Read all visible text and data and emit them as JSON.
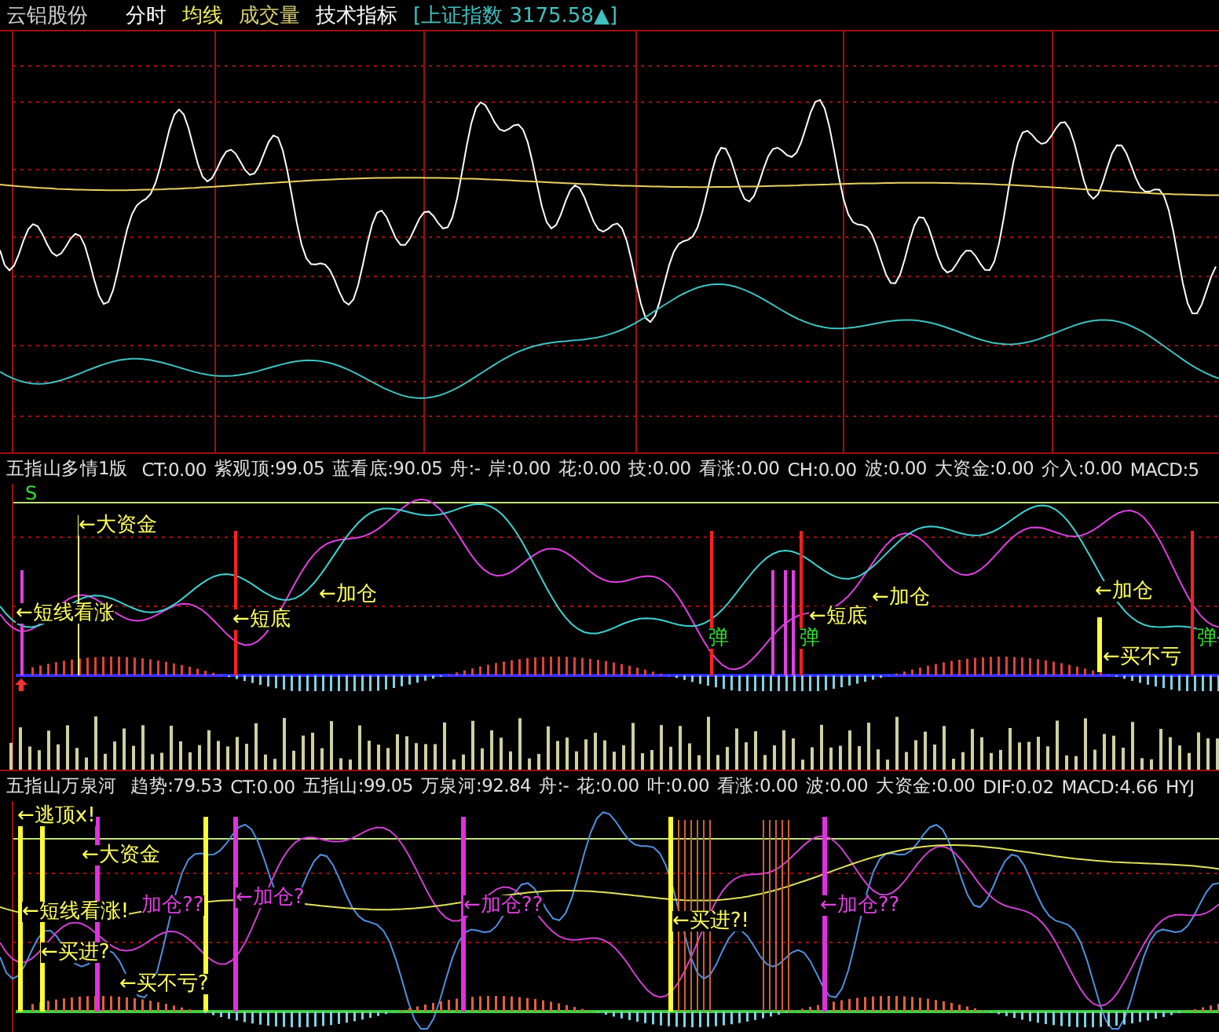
{
  "top_bar": [
    {
      "label": "云铝股份",
      "color": "#d0d0d0"
    },
    {
      "label": "分时",
      "color": "#ffffff"
    },
    {
      "label": "均线",
      "color": "#f0f060"
    },
    {
      "label": "成交量",
      "color": "#d8d070"
    },
    {
      "label": "技术指标",
      "color": "#ffffff"
    },
    {
      "label": "[上证指数 3175.58▲]",
      "color": "#40c0c0"
    }
  ],
  "indicator_1": {
    "name": "五指山多情1版",
    "fields": [
      "CT:0.00",
      "紫观顶:99.05",
      "蓝看底:90.05",
      "舟:-",
      "岸:0.00",
      "花:0.00",
      "技:0.00",
      "看涨:0.00",
      "CH:0.00",
      "波:0.00",
      "大资金:0.00",
      "介入:0.00",
      "MACD:5"
    ],
    "signal": "S",
    "annotations": [
      {
        "text": "←大资金",
        "color": "#ffff60"
      },
      {
        "text": "←短线看涨",
        "color": "#ffff60"
      },
      {
        "text": "←短底",
        "color": "#ffff60"
      },
      {
        "text": "←加仓",
        "color": "#ffff60"
      },
      {
        "text": "弹",
        "color": "#30e030"
      },
      {
        "text": "弹",
        "color": "#30e030"
      },
      {
        "text": "←短底",
        "color": "#ffff60"
      },
      {
        "text": "←加仓",
        "color": "#ffff60"
      },
      {
        "text": "←加仓",
        "color": "#ffff60"
      },
      {
        "text": "←买不亏",
        "color": "#ffff60"
      },
      {
        "text": "弹",
        "color": "#30e030"
      }
    ]
  },
  "indicator_2": {
    "name": "五指山万泉河",
    "fields": [
      "趋势:79.53",
      "CT:0.00",
      "五指山:99.05",
      "万泉河:92.84",
      "舟:-",
      "花:0.00",
      "叶:0.00",
      "看涨:0.00",
      "波:0.00",
      "大资金:0.00",
      "DIF:0.02",
      "MACD:4.66",
      "HYJ"
    ],
    "annotations": [
      {
        "text": "←逃顶x!",
        "color": "#ffff60"
      },
      {
        "text": "←大资金",
        "color": "#ffff60"
      },
      {
        "text": "←短线看涨!",
        "color": "#ffff60"
      },
      {
        "text": "加仓??",
        "color": "#e040e0"
      },
      {
        "text": "←加仓?",
        "color": "#e040e0"
      },
      {
        "text": "←买进?",
        "color": "#ffff60"
      },
      {
        "text": "←买不亏?",
        "color": "#ffff60"
      },
      {
        "text": "←加仓??",
        "color": "#e040e0"
      },
      {
        "text": "←买进?!",
        "color": "#ffff60"
      },
      {
        "text": "←加仓??",
        "color": "#e040e0"
      }
    ]
  }
}
